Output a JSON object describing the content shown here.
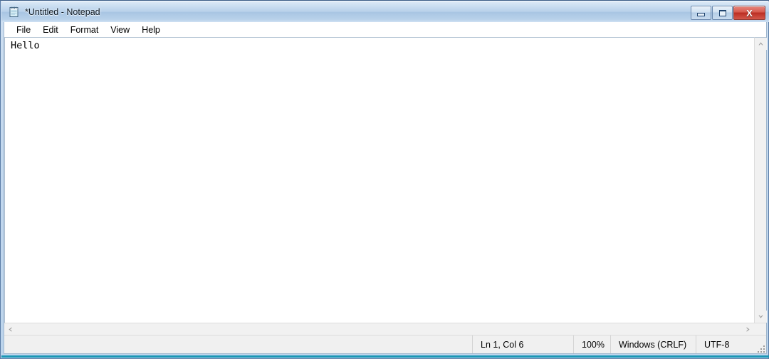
{
  "window": {
    "title": "*Untitled - Notepad",
    "icon": "notepad-icon",
    "controls": {
      "minimize_label": "–",
      "maximize_label": "□",
      "close_label": "X"
    }
  },
  "menu": {
    "items": [
      {
        "label": "File"
      },
      {
        "label": "Edit"
      },
      {
        "label": "Format"
      },
      {
        "label": "View"
      },
      {
        "label": "Help"
      }
    ]
  },
  "editor": {
    "text": "Hello",
    "placeholder": ""
  },
  "scrollbars": {
    "vertical": {
      "up_arrow": "▲",
      "down_arrow": "▼"
    },
    "horizontal": {
      "left_arrow": "◀",
      "right_arrow": "▶"
    }
  },
  "status_bar": {
    "position": "Ln 1, Col 6",
    "zoom": "100%",
    "line_ending": "Windows (CRLF)",
    "encoding": "UTF-8"
  },
  "colors": {
    "titlebar_accent": "#b7d0e9",
    "close_button": "#bb2e23",
    "frame_border": "#5a7ca6",
    "frame_accent": "#1a97b5",
    "client_background": "#ffffff",
    "status_background": "#f0f0f0"
  }
}
